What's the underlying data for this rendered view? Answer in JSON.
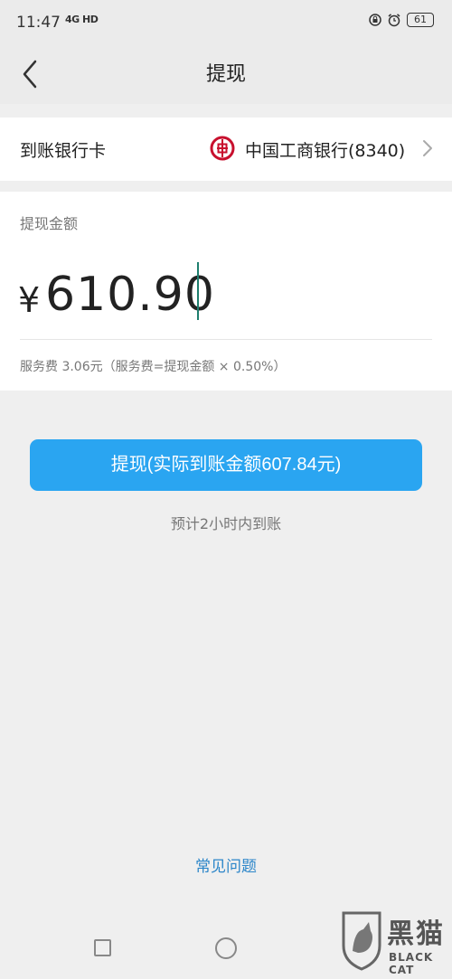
{
  "status_bar": {
    "time": "11:47",
    "network": "4G HD",
    "battery": "61"
  },
  "header": {
    "title": "提现"
  },
  "bank": {
    "label": "到账银行卡",
    "name": "中国工商银行(8340)"
  },
  "amount": {
    "label": "提现金额",
    "currency_symbol": "¥",
    "value": "610.90",
    "fee_text": "服务费 3.06元（服务费=提现金额 × 0.50%）"
  },
  "actions": {
    "withdraw_label": "提现(实际到账金额607.84元)",
    "eta_text": "预计2小时内到账",
    "faq_label": "常见问题"
  },
  "watermark": {
    "chars": "黑猫",
    "sub": "BLACK CAT"
  },
  "colors": {
    "accent": "#2aa5f1",
    "link": "#2c86c9",
    "bank_logo": "#c8102e",
    "cursor": "#1e7e6e"
  }
}
